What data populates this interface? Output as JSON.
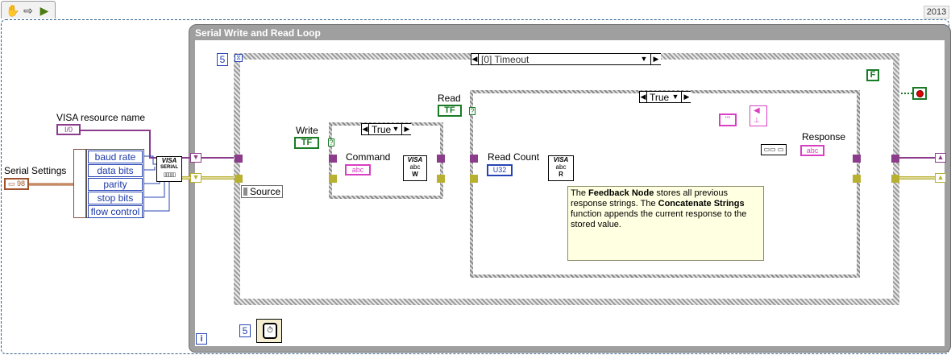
{
  "toolbar": {
    "hand_icon": "hand-tool-icon",
    "arrow_icon": "arrow-tool-icon",
    "run_icon": "run-icon"
  },
  "version_tab": "2013",
  "loop": {
    "title": "Serial Write and Read Loop",
    "wait_ms": "5",
    "iteration": "i"
  },
  "event": {
    "timeout_value": "5",
    "case_label": "[0] Timeout",
    "source_label": "Source"
  },
  "write_case": {
    "label": "Write",
    "bool": "TF",
    "selector": "True",
    "command_label": "Command",
    "command_term": "abc"
  },
  "read_case": {
    "label": "Read",
    "bool": "TF",
    "selector": "True",
    "read_count_label": "Read Count",
    "read_count_term": "U32",
    "response_label": "Response",
    "response_term": "abc"
  },
  "config": {
    "resource_label": "VISA resource name",
    "resource_term": "I/0",
    "serial_settings_label": "Serial Settings",
    "fields": [
      "baud rate",
      "data bits",
      "parity",
      "stop bits",
      "flow control"
    ]
  },
  "comment": {
    "p1": "The ",
    "b1": "Feedback Node",
    "p2": " stores all previous response strings. The ",
    "b2": "Concatenate Strings",
    "p3": " function appends the current response to the stored value."
  },
  "stop": {
    "bool": "F"
  },
  "colors": {
    "wire_visa": "#8b3d8b",
    "wire_error": "#b8b030",
    "wire_string": "#e040d0",
    "wire_bool": "#1a7a26",
    "wire_numeric": "#2844b4",
    "loop_border": "#9f9f9f"
  }
}
